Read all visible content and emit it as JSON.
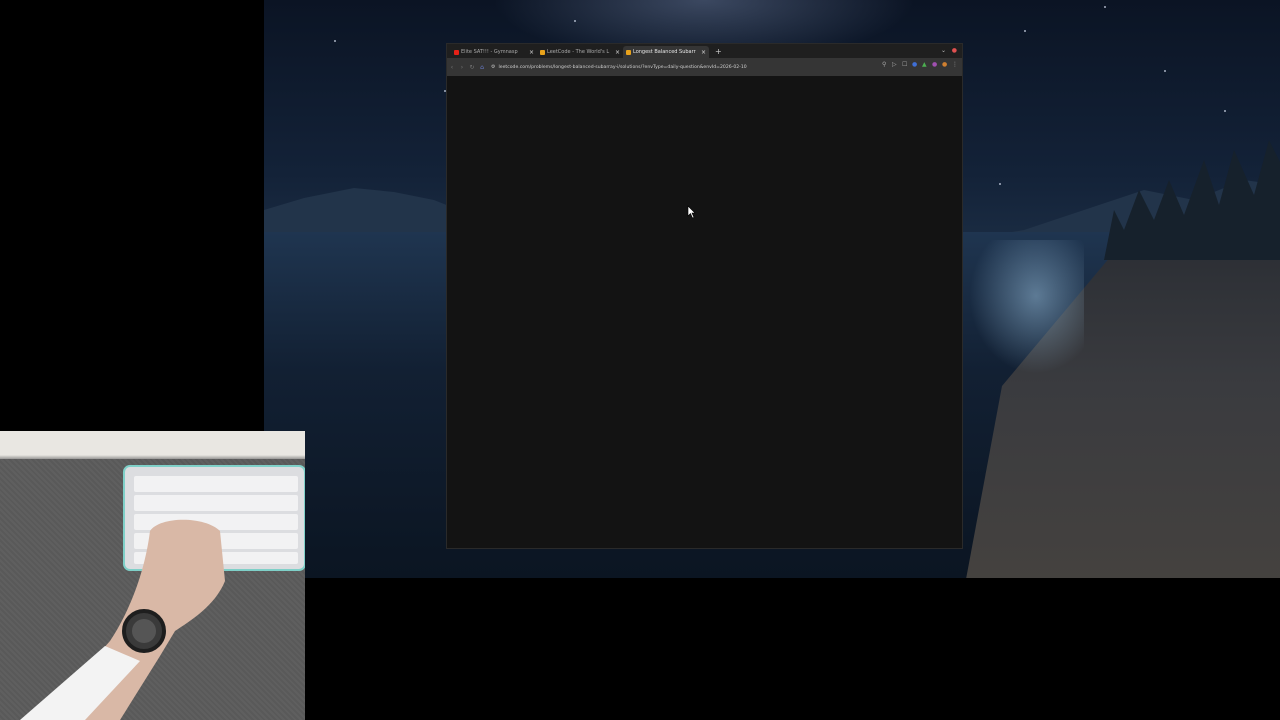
{
  "browser": {
    "tabs": [
      {
        "label": "Elite SAT!!! - Gymnasp",
        "icon": "youtube-icon",
        "active": false
      },
      {
        "label": "LeetCode - The World's L",
        "icon": "leetcode-icon",
        "active": false
      },
      {
        "label": "Longest Balanced Subarr",
        "icon": "leetcode-icon",
        "active": true
      }
    ],
    "new_tab_label": "+",
    "close_glyph": "×",
    "address_url": "leetcode.com/problems/longest-balanced-subarray-i/solutions/?envType=daily-question&envId=2026-02-10"
  },
  "colors": {
    "page_background": "#000000",
    "browser_content": "#131313",
    "tabbar": "#1f1f1f",
    "toolbar": "#353535"
  }
}
